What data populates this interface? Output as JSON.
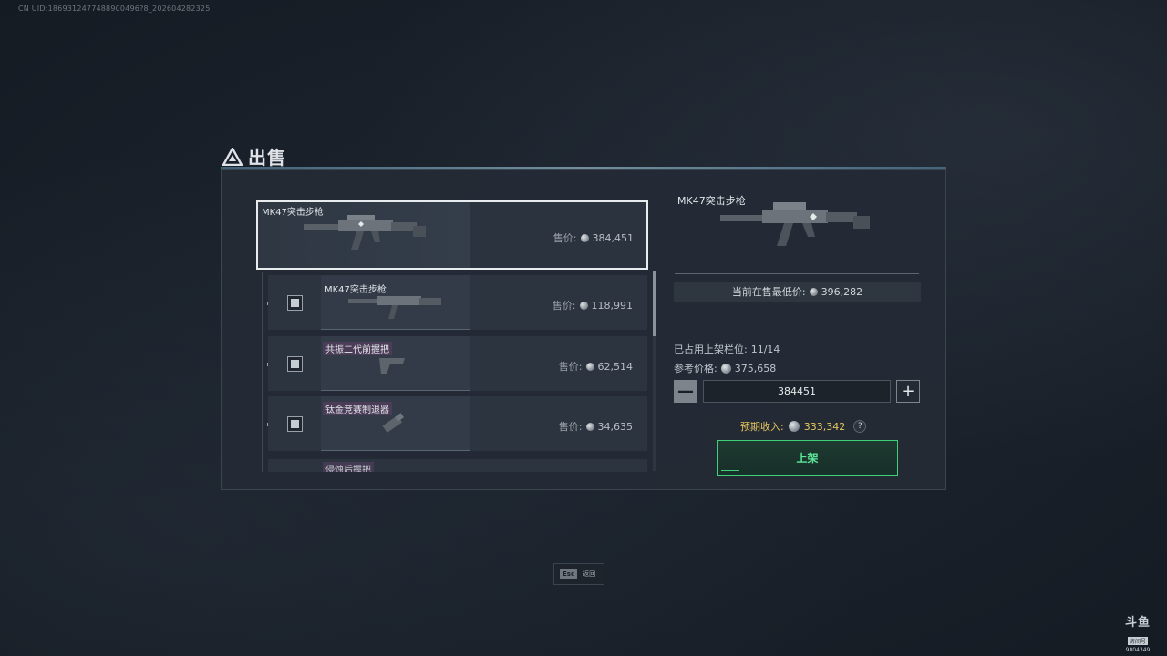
{
  "header": {
    "uid_text": "CN UID:1869312477488900496?8_202604282325",
    "title": "出售"
  },
  "main_item": {
    "name": "MK47突击步枪",
    "price_label": "售价:",
    "price": "384,451"
  },
  "sub_items": [
    {
      "name": "MK47突击步枪",
      "price_label": "售价:",
      "price": "118,991",
      "checked": true,
      "tagged": false
    },
    {
      "name": "共振二代前握把",
      "price_label": "售价:",
      "price": "62,514",
      "checked": true,
      "tagged": true
    },
    {
      "name": "钛金竞赛制退器",
      "price_label": "售价:",
      "price": "34,635",
      "checked": true,
      "tagged": true
    },
    {
      "name": "侵蚀后握把",
      "price_label": "",
      "price": "",
      "checked": false,
      "tagged": true
    }
  ],
  "detail": {
    "name": "MK47突击步枪",
    "lowest_label": "当前在售最低价:",
    "lowest_price": "396,282",
    "slots_label": "已占用上架栏位:",
    "slots_value": "11/14",
    "ref_label": "参考价格:",
    "ref_price": "375,658",
    "input_value": "384451",
    "minus_label": "—",
    "plus_label": "+",
    "income_label": "预期收入:",
    "income_value": "333,342",
    "help_label": "?",
    "list_button": "上架"
  },
  "footer": {
    "esc_key": "Esc",
    "esc_label": "返回"
  },
  "watermark": {
    "brand": "斗鱼",
    "sub": "房间号",
    "room": "9804349"
  },
  "colors": {
    "accent_green": "#3fd07a",
    "income_gold": "#e6c75e",
    "selection_border": "#e8ecef"
  }
}
